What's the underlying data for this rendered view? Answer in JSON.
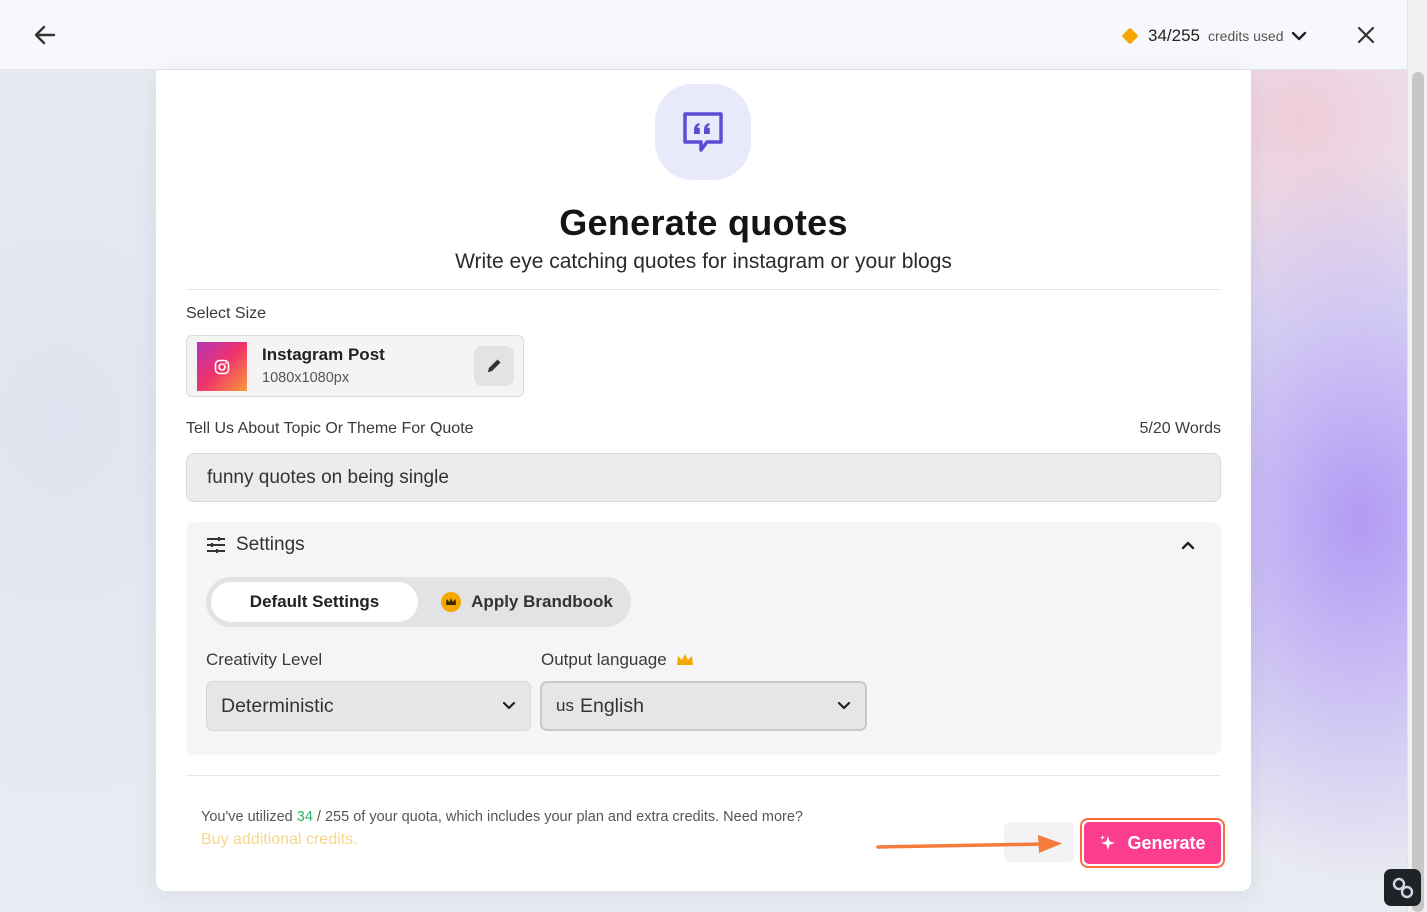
{
  "header": {
    "credits_count": "34/255",
    "credits_label": "credits used"
  },
  "page": {
    "title": "Generate quotes",
    "subtitle": "Write eye catching quotes for instagram or your blogs"
  },
  "size": {
    "label": "Select Size",
    "name": "Instagram Post",
    "dimensions": "1080x1080px"
  },
  "topic": {
    "label": "Tell Us About Topic Or Theme For Quote",
    "word_count": "5/20 Words",
    "value": "funny quotes on being single"
  },
  "settings": {
    "title": "Settings",
    "tab_default": "Default Settings",
    "tab_brandbook": "Apply Brandbook",
    "creativity_label": "Creativity Level",
    "creativity_value": "Deterministic",
    "language_label": "Output language",
    "language_flag": "us",
    "language_value": "English"
  },
  "footer": {
    "quota_prefix": "You've utilized ",
    "quota_used": "34",
    "quota_sep": " / ",
    "quota_total": "255",
    "quota_suffix": " of your quota, which includes your plan and extra credits. Need more?",
    "buy_link": "Buy additional credits.",
    "generate_label": "Generate"
  },
  "colors": {
    "accent_pink": "#fb3c8f",
    "highlight_orange": "#ff6b3d",
    "credit_gold": "#f5a700",
    "hero_purple": "#5b4cd6"
  }
}
